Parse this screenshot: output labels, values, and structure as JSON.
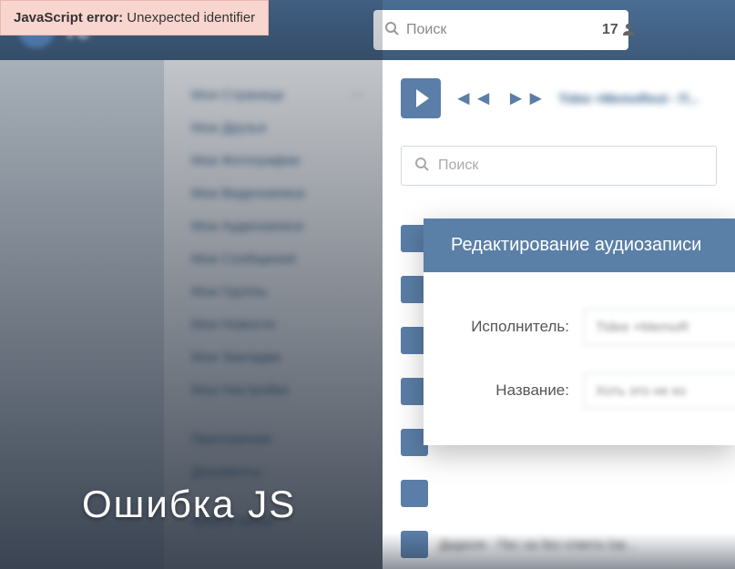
{
  "error": {
    "label": "JavaScript error:",
    "message": "Unexpected identifier"
  },
  "header": {
    "logo_text": "те",
    "search": {
      "placeholder": "Поиск",
      "count": "17"
    }
  },
  "sidebar": {
    "items": [
      {
        "label": "Моя Страница",
        "badge": ""
      },
      {
        "label": "Мои Друзья",
        "badge": ""
      },
      {
        "label": "Мои Фотографии",
        "badge": ""
      },
      {
        "label": "Мои Видеозаписи",
        "badge": ""
      },
      {
        "label": "Мои Аудиозаписи",
        "badge": ""
      },
      {
        "label": "Мои Сообщения",
        "badge": ""
      },
      {
        "label": "Мои Группы",
        "badge": ""
      },
      {
        "label": "Мои Новости",
        "badge": ""
      },
      {
        "label": "Мои Закладки",
        "badge": ""
      },
      {
        "label": "Мои Настройки",
        "badge": ""
      }
    ],
    "extra": [
      {
        "label": "Приложения"
      },
      {
        "label": "Документы"
      }
    ],
    "bottom": [
      {
        "label": "пункты меню"
      }
    ]
  },
  "player": {
    "track": "Tidee ×MemoReut - П..."
  },
  "mainSearch": {
    "placeholder": "Поиск"
  },
  "audioList": {
    "rows": [
      {
        "text": ""
      },
      {
        "text": ""
      },
      {
        "text": ""
      },
      {
        "text": ""
      },
      {
        "text": ""
      },
      {
        "text": ""
      },
      {
        "text": "Дидюля - Пес на без ответа /ож..."
      }
    ]
  },
  "modal": {
    "title": "Редактирование аудиозаписи",
    "fields": {
      "artist_label": "Исполнитель:",
      "artist_value": "Tidee ×MemoR",
      "title_label": "Название:",
      "title_value": "Хоть это не ко"
    }
  },
  "overlay": {
    "text": "Ошибка JS"
  }
}
